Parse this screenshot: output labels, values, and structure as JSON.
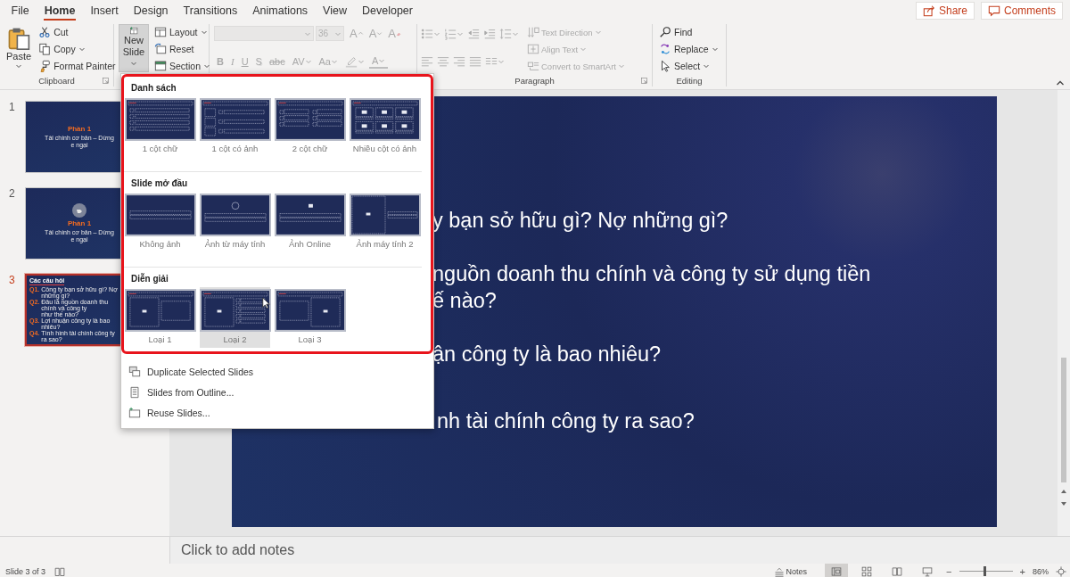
{
  "tabs": [
    {
      "label": "File",
      "selected": false
    },
    {
      "label": "Home",
      "selected": true
    },
    {
      "label": "Insert",
      "selected": false
    },
    {
      "label": "Design",
      "selected": false
    },
    {
      "label": "Transitions",
      "selected": false
    },
    {
      "label": "Animations",
      "selected": false
    },
    {
      "label": "View",
      "selected": false
    },
    {
      "label": "Developer",
      "selected": false
    }
  ],
  "header_buttons": [
    {
      "kind": "share",
      "label": "Share"
    },
    {
      "kind": "comments",
      "label": "Comments"
    }
  ],
  "clipboard": {
    "label": "Clipboard",
    "paste": "Paste",
    "items": [
      {
        "kind": "cut",
        "label": "Cut",
        "dropdown": false
      },
      {
        "kind": "copy",
        "label": "Copy",
        "dropdown": true
      },
      {
        "kind": "painter",
        "label": "Format Painter",
        "dropdown": false
      }
    ]
  },
  "slides_group": {
    "new_slide": "New Slide",
    "new_slide_open": true,
    "items": [
      {
        "kind": "layout",
        "label": "Layout",
        "dropdown": true
      },
      {
        "kind": "reset",
        "label": "Reset",
        "dropdown": false
      },
      {
        "kind": "section",
        "label": "Section",
        "dropdown": true
      }
    ]
  },
  "font": {
    "disabled": true,
    "size": "36",
    "row1": [
      {
        "kind": "grow",
        "label": "A"
      },
      {
        "kind": "shrink",
        "label": "A"
      },
      {
        "kind": "clear",
        "label": "A"
      }
    ],
    "row2": [
      {
        "kind": "bold",
        "label": "B",
        "dropdown": false
      },
      {
        "kind": "italic",
        "label": "I",
        "dropdown": false
      },
      {
        "kind": "underline",
        "label": "U",
        "dropdown": false
      },
      {
        "kind": "shadow",
        "label": "S",
        "dropdown": false
      },
      {
        "kind": "strike",
        "label": "abc",
        "dropdown": false
      },
      {
        "kind": "spacing",
        "label": "AV",
        "dropdown": true
      },
      {
        "kind": "case",
        "label": "Aa",
        "dropdown": true
      },
      {
        "kind": "highlight",
        "dropdown": true
      },
      {
        "kind": "color",
        "label": "A",
        "dropdown": true
      }
    ]
  },
  "paragraph": {
    "label": "Paragraph",
    "disabled": true,
    "row1": [
      {
        "kind": "bullets",
        "dropdown": true
      },
      {
        "kind": "numbering",
        "dropdown": true
      },
      {
        "kind": "outdent",
        "dropdown": false
      },
      {
        "kind": "indent",
        "dropdown": false
      },
      {
        "kind": "line-spacing",
        "dropdown": true
      }
    ],
    "row2": [
      {
        "kind": "align-left",
        "dropdown": false
      },
      {
        "kind": "align-center",
        "dropdown": false
      },
      {
        "kind": "align-right",
        "dropdown": false
      },
      {
        "kind": "justify",
        "dropdown": false
      },
      {
        "kind": "columns",
        "dropdown": true
      }
    ],
    "commands": [
      {
        "kind": "direction",
        "label": "Text Direction",
        "dropdown": true
      },
      {
        "kind": "align",
        "label": "Align Text",
        "dropdown": true
      },
      {
        "kind": "smartart",
        "label": "Convert to SmartArt",
        "dropdown": true
      }
    ]
  },
  "editing": {
    "label": "Editing",
    "items": [
      {
        "kind": "find",
        "label": "Find",
        "dropdown": false
      },
      {
        "kind": "replace",
        "label": "Replace",
        "dropdown": true
      },
      {
        "kind": "select",
        "label": "Select",
        "dropdown": true
      }
    ]
  },
  "thumbnails": [
    {
      "number": "1",
      "selected": false,
      "kind": "section",
      "title": "Phần 1",
      "subtitle": "Tài chính cơ bản – Dừng e ngại"
    },
    {
      "number": "2",
      "selected": false,
      "kind": "section-icon",
      "title": "Phần 1",
      "subtitle": "Tài chính cơ bản – Dừng e ngại"
    },
    {
      "number": "3",
      "selected": true,
      "kind": "questions",
      "title": "Các câu hỏi",
      "questions": [
        {
          "mark": "Q1.",
          "text": "Công ty bạn sở hữu gì? Nợ những gì?"
        },
        {
          "mark": "Q2.",
          "text": "Đâu là nguồn doanh thu chính và công ty\nnhư thế nào?"
        },
        {
          "mark": "Q3.",
          "text": "Lợi nhuận công ty là bao nhiêu?"
        },
        {
          "mark": "Q4.",
          "text": "Tình hình tài chính công ty ra sao?"
        }
      ]
    }
  ],
  "slide": {
    "lines": [
      "y bạn sở hữu gì? Nợ những gì?",
      "nguồn doanh thu chính và công ty sử dụng tiền\nế nào?",
      "ận công ty là bao nhiêu?",
      "nh tài chính công ty ra sao?"
    ]
  },
  "new_slide_menu": {
    "sections": [
      {
        "title": "Danh sách",
        "layouts": [
          {
            "label": "1 cột chữ",
            "kind": "list",
            "selected": false
          },
          {
            "label": "1 cột có ảnh",
            "kind": "list-image",
            "selected": false
          },
          {
            "label": "2 cột chữ",
            "kind": "two-lists",
            "selected": false
          },
          {
            "label": "Nhiều cột có ảnh",
            "kind": "image-grid",
            "selected": false
          }
        ]
      },
      {
        "title": "Slide mở đầu",
        "layouts": [
          {
            "label": "Không ảnh",
            "kind": "title",
            "selected": false
          },
          {
            "label": "Ảnh từ máy tính",
            "kind": "title-circle",
            "selected": false
          },
          {
            "label": "Ảnh Online",
            "kind": "title-online",
            "selected": false
          },
          {
            "label": "Ảnh máy tính 2",
            "kind": "image-title",
            "selected": false
          }
        ]
      },
      {
        "title": "Diễn giải",
        "layouts": [
          {
            "label": "Loại 1",
            "kind": "image-box",
            "selected": false
          },
          {
            "label": "Loại 2",
            "kind": "image-list",
            "selected": true
          },
          {
            "label": "Loại 3",
            "kind": "box-image",
            "selected": false
          }
        ]
      }
    ],
    "commands": [
      {
        "kind": "duplicate",
        "label": "Duplicate Selected Slides"
      },
      {
        "kind": "outline",
        "label": "Slides from Outline..."
      },
      {
        "kind": "reuse",
        "label": "Reuse Slides..."
      }
    ]
  },
  "notes": {
    "placeholder": "Click to add notes"
  },
  "status_bar": {
    "slide_info": "Slide 3 of 3",
    "notes": "Notes",
    "views": [
      {
        "kind": "normal",
        "selected": true
      },
      {
        "kind": "sorter",
        "selected": false
      },
      {
        "kind": "reading",
        "selected": false
      },
      {
        "kind": "slideshow",
        "selected": false
      }
    ],
    "zoom_out": "−",
    "zoom_in": "+",
    "zoom": {
      "level": 0.45
    },
    "zoom_text": "86%"
  }
}
